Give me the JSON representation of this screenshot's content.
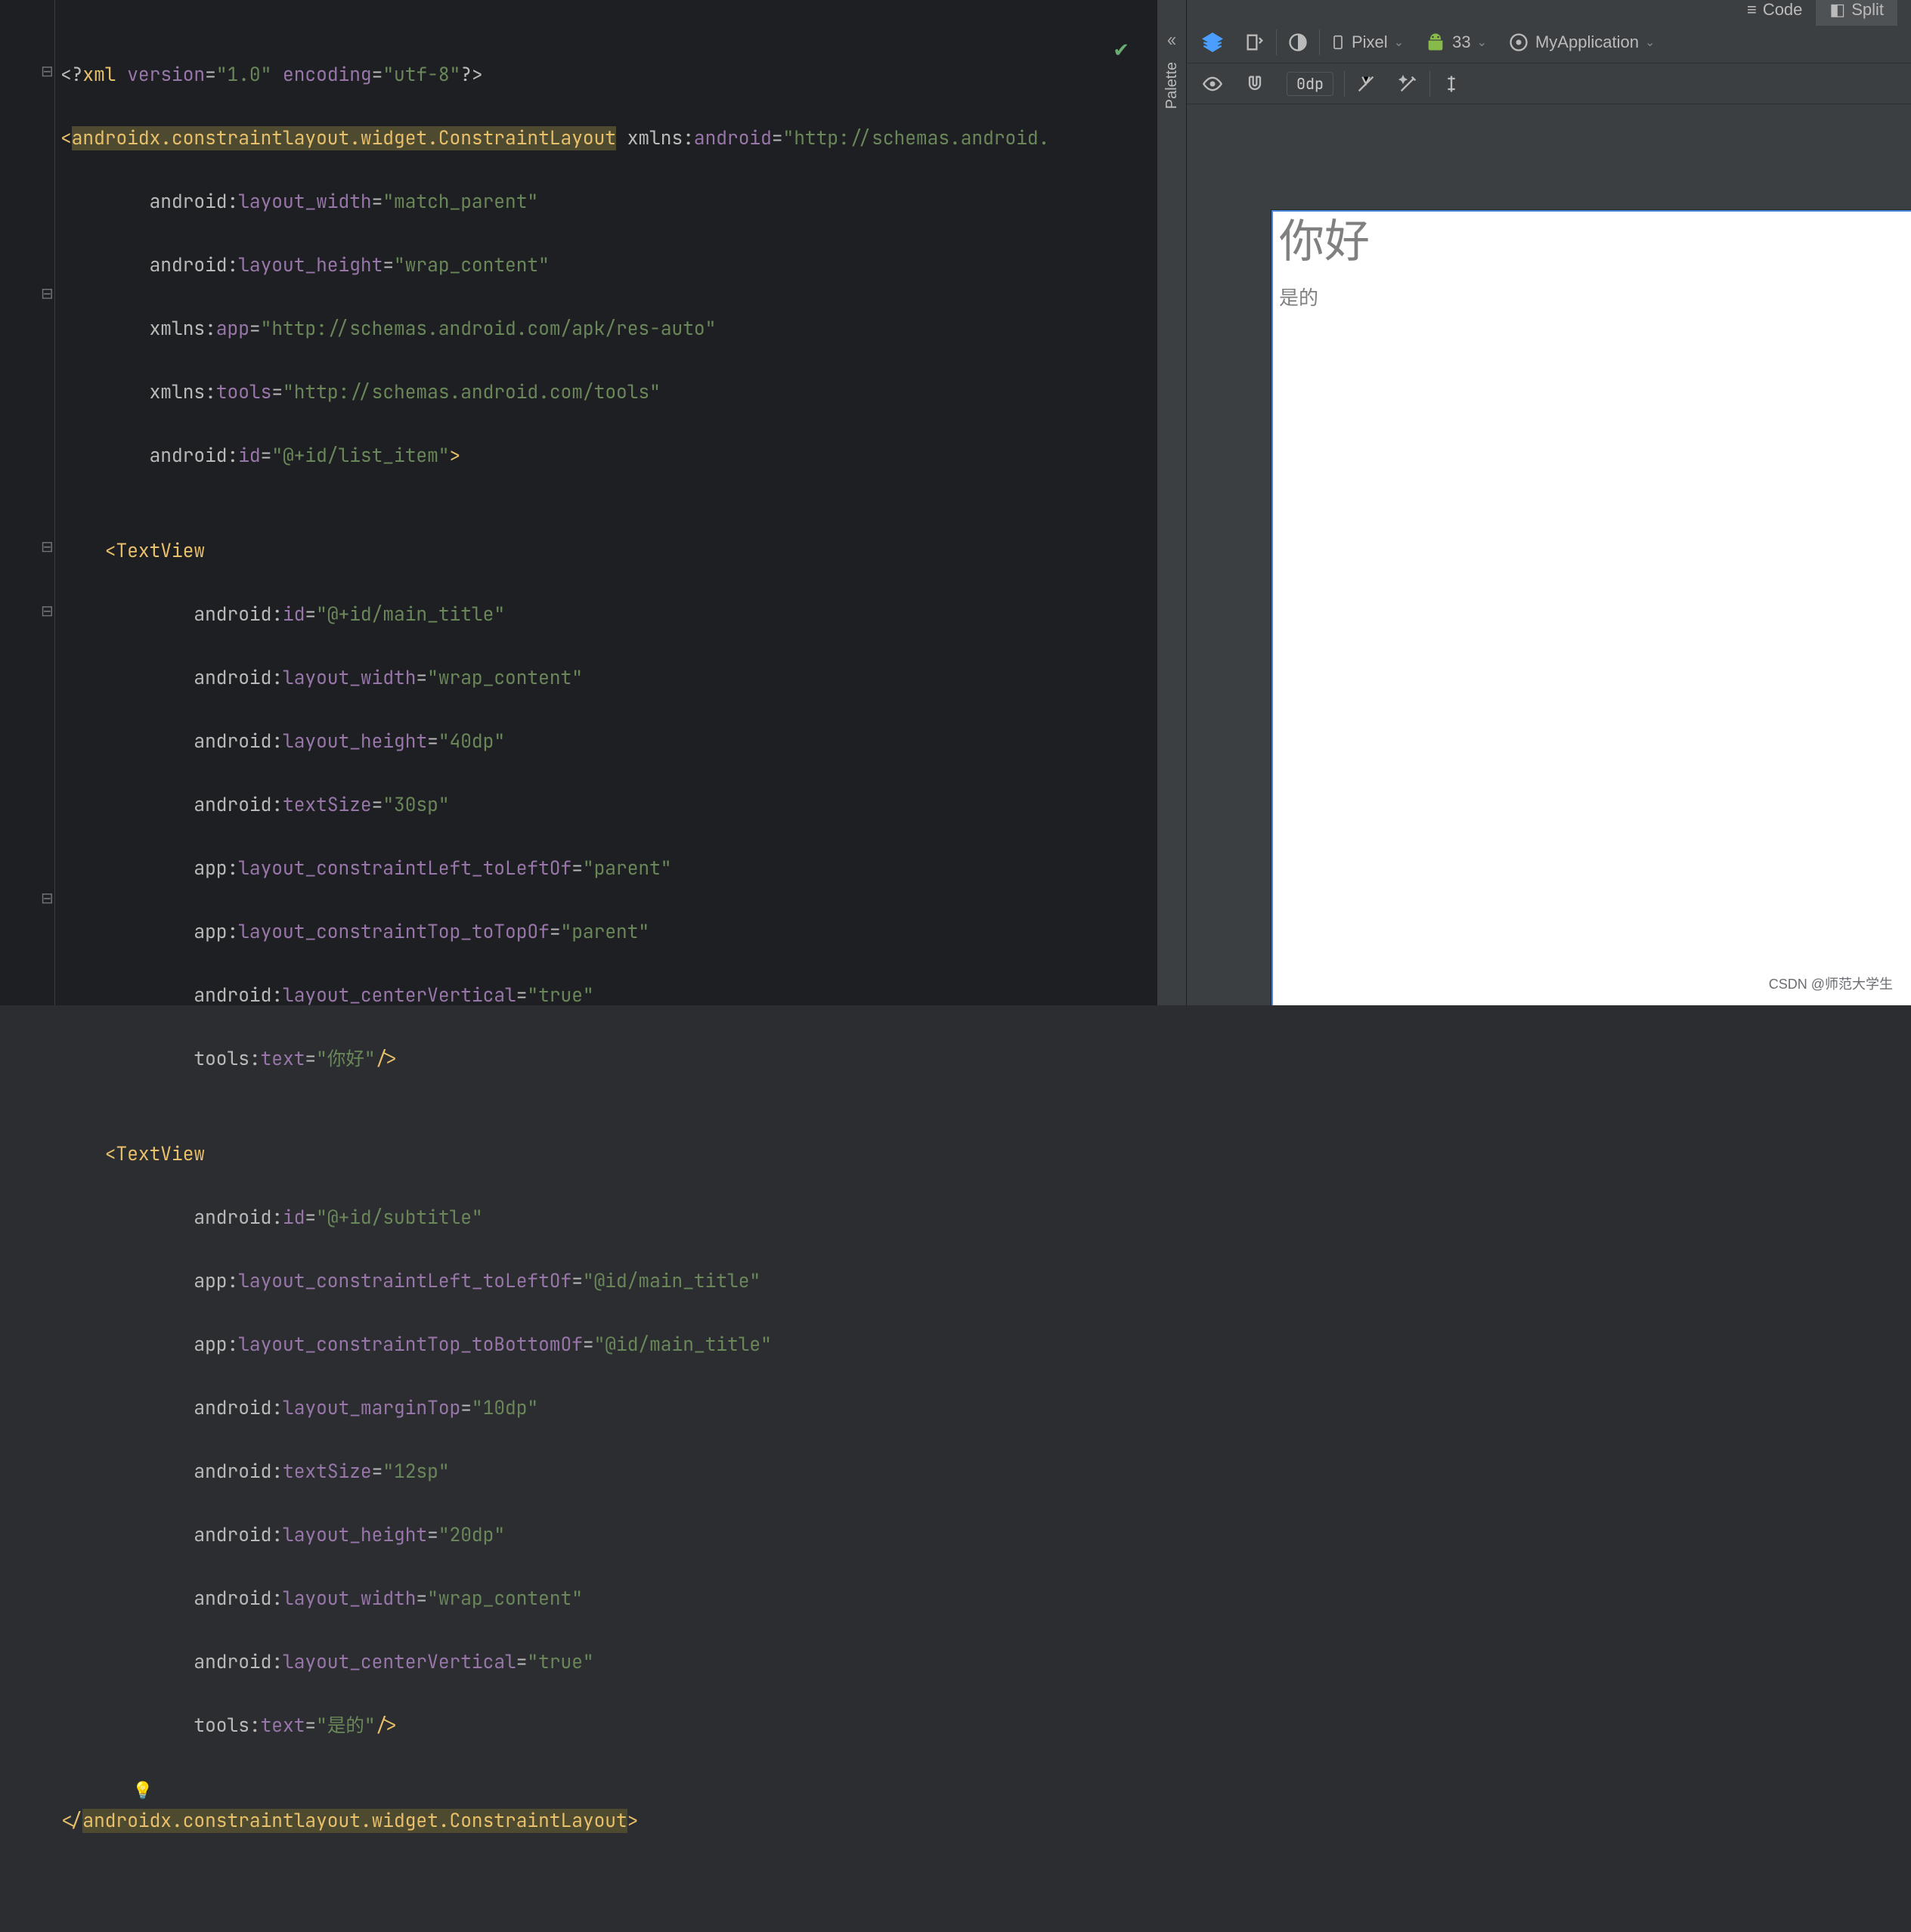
{
  "tabs": {
    "code": "Code",
    "split": "Split"
  },
  "toolbar": {
    "device": "Pixel",
    "api": "33",
    "app": "MyApplication",
    "dp": "0dp"
  },
  "palette": {
    "label": "Palette"
  },
  "preview": {
    "title": "你好",
    "subtitle": "是的"
  },
  "watermark": "CSDN @师范大学生",
  "code": {
    "l1a": "<?",
    "l1b": "xml",
    "l1c": " version",
    "l1d": "=",
    "l1e": "\"1.0\"",
    "l1f": " encoding",
    "l1g": "=",
    "l1h": "\"utf-8\"",
    "l1i": "?>",
    "l2a": "<",
    "l2b": "androidx.constraintlayout.widget.ConstraintLayout",
    "l2c": " xmlns:",
    "l2d": "android",
    "l2e": "=",
    "l2f": "\"http://schemas.android.",
    "l3a": "        android",
    "l3b": ":",
    "l3c": "layout_width",
    "l3d": "=",
    "l3e": "\"match_parent\"",
    "l4a": "        android",
    "l4b": ":",
    "l4c": "layout_height",
    "l4d": "=",
    "l4e": "\"wrap_content\"",
    "l5a": "        xmlns:",
    "l5b": "app",
    "l5c": "=",
    "l5d": "\"http://schemas.android.com/apk/res-auto\"",
    "l6a": "        xmlns:",
    "l6b": "tools",
    "l6c": "=",
    "l6d": "\"http://schemas.android.com/tools\"",
    "l7a": "        android",
    "l7b": ":",
    "l7c": "id",
    "l7d": "=",
    "l7e": "\"@+id/list_item\"",
    "l7f": ">",
    "l8": "",
    "l9a": "    <",
    "l9b": "TextView",
    "l10a": "            android",
    "l10b": ":",
    "l10c": "id",
    "l10d": "=",
    "l10e": "\"@+id/main_title\"",
    "l11a": "            android",
    "l11b": ":",
    "l11c": "layout_width",
    "l11d": "=",
    "l11e": "\"wrap_content\"",
    "l12a": "            android",
    "l12b": ":",
    "l12c": "layout_height",
    "l12d": "=",
    "l12e": "\"40dp\"",
    "l13a": "            android",
    "l13b": ":",
    "l13c": "textSize",
    "l13d": "=",
    "l13e": "\"30sp\"",
    "l14a": "            app",
    "l14b": ":",
    "l14c": "layout_constraintLeft_toLeftOf",
    "l14d": "=",
    "l14e": "\"parent\"",
    "l15a": "            app",
    "l15b": ":",
    "l15c": "layout_constraintTop_toTopOf",
    "l15d": "=",
    "l15e": "\"parent\"",
    "l16a": "            android",
    "l16b": ":",
    "l16c": "layout_centerVertical",
    "l16d": "=",
    "l16e": "\"true\"",
    "l17a": "            tools",
    "l17b": ":",
    "l17c": "text",
    "l17d": "=",
    "l17e": "\"你好\"",
    "l17f": "/>",
    "l18": "",
    "l19a": "    <",
    "l19b": "TextView",
    "l20a": "            android",
    "l20b": ":",
    "l20c": "id",
    "l20d": "=",
    "l20e": "\"@+id/subtitle\"",
    "l21a": "            app",
    "l21b": ":",
    "l21c": "layout_constraintLeft_toLeftOf",
    "l21d": "=",
    "l21e": "\"@id/main_title\"",
    "l22a": "            app",
    "l22b": ":",
    "l22c": "layout_constraintTop_toBottomOf",
    "l22d": "=",
    "l22e": "\"@id/main_title\"",
    "l23a": "            android",
    "l23b": ":",
    "l23c": "layout_marginTop",
    "l23d": "=",
    "l23e": "\"10dp\"",
    "l24a": "            android",
    "l24b": ":",
    "l24c": "textSize",
    "l24d": "=",
    "l24e": "\"12sp\"",
    "l25a": "            android",
    "l25b": ":",
    "l25c": "layout_height",
    "l25d": "=",
    "l25e": "\"20dp\"",
    "l26a": "            android",
    "l26b": ":",
    "l26c": "layout_width",
    "l26d": "=",
    "l26e": "\"wrap_content\"",
    "l27a": "            android",
    "l27b": ":",
    "l27c": "layout_centerVertical",
    "l27d": "=",
    "l27e": "\"true\"",
    "l28a": "            tools",
    "l28b": ":",
    "l28c": "text",
    "l28d": "=",
    "l28e": "\"是的\"",
    "l28f": "/>",
    "l29": "",
    "l30a": "</",
    "l30b": "androidx.constraintlayout.widget.ConstraintLayout",
    "l30c": ">"
  }
}
